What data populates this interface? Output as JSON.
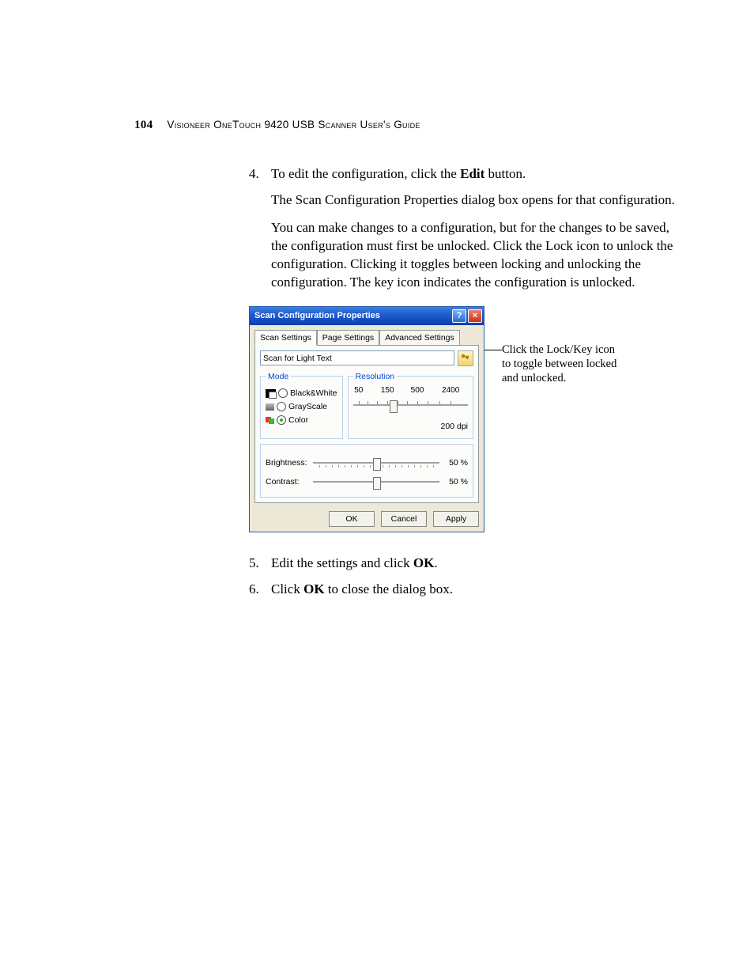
{
  "header": {
    "page_number": "104",
    "title": "Visioneer OneTouch 9420 USB Scanner User's Guide"
  },
  "step4": {
    "intro_a": "To edit the configuration, click the ",
    "intro_bold": "Edit",
    "intro_b": " button.",
    "p1": "The Scan Configuration Properties dialog box opens for that configuration.",
    "p2": "You can make changes to a configuration, but for the changes to be saved, the configuration must first be unlocked. Click the Lock icon to unlock the configuration. Clicking it toggles between locking and unlocking the configuration. The key icon indicates the configuration is unlocked."
  },
  "dialog": {
    "title": "Scan Configuration Properties",
    "tabs": [
      "Scan Settings",
      "Page Settings",
      "Advanced Settings"
    ],
    "config_name": "Scan for Light Text",
    "mode_legend": "Mode",
    "modes": {
      "bw": "Black&White",
      "gs": "GrayScale",
      "cl": "Color"
    },
    "resolution_legend": "Resolution",
    "res_marks": [
      "50",
      "150",
      "500",
      "2400"
    ],
    "res_value": "200 dpi",
    "brightness_label": "Brightness:",
    "brightness_value": "50 %",
    "contrast_label": "Contrast:",
    "contrast_value": "50 %",
    "buttons": {
      "ok": "OK",
      "cancel": "Cancel",
      "apply": "Apply"
    }
  },
  "callout": "Click the Lock/Key icon to toggle between locked and unlocked.",
  "step5": {
    "a": "Edit the settings and click ",
    "bold": "OK",
    "b": "."
  },
  "step6": {
    "a": "Click ",
    "bold": "OK",
    "b": " to close the dialog box."
  }
}
